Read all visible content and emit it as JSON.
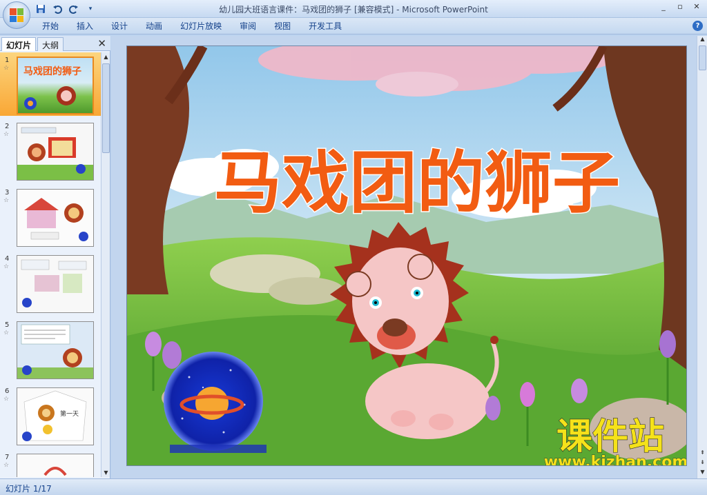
{
  "window": {
    "title": "幼儿园大班语言课件：马戏团的狮子 [兼容模式] - Microsoft PowerPoint",
    "controls": [
      "_",
      "▫",
      "✕"
    ]
  },
  "quick_access": {
    "save_icon": "save-icon",
    "undo_icon": "undo-icon",
    "redo_icon": "redo-icon"
  },
  "ribbon": {
    "tabs": [
      "开始",
      "插入",
      "设计",
      "动画",
      "幻灯片放映",
      "审阅",
      "视图",
      "开发工具"
    ]
  },
  "left_pane": {
    "tabs": {
      "slides": "幻灯片",
      "outline": "大纲"
    },
    "close": "✕",
    "thumbnails": [
      {
        "num": "1",
        "star": "☆"
      },
      {
        "num": "2",
        "star": "☆"
      },
      {
        "num": "3",
        "star": "☆"
      },
      {
        "num": "4",
        "star": "☆"
      },
      {
        "num": "5",
        "star": "☆"
      },
      {
        "num": "6",
        "star": "☆"
      },
      {
        "num": "7",
        "star": "☆"
      }
    ],
    "thumb_texts": {
      "t1_title": "马戏团的狮子",
      "t6_label": "第一天"
    }
  },
  "slide": {
    "title": "马戏团的狮子",
    "watermark_main": "课件站",
    "watermark_url": "www.kjzhan.com"
  },
  "status": {
    "text": "幻灯片 1/17"
  },
  "colors": {
    "title_orange": "#f25c12",
    "sky": "#a9cde9",
    "grass": "#6cb63a",
    "mane": "#a5311d",
    "watermark_yellow": "#f5e21a"
  }
}
